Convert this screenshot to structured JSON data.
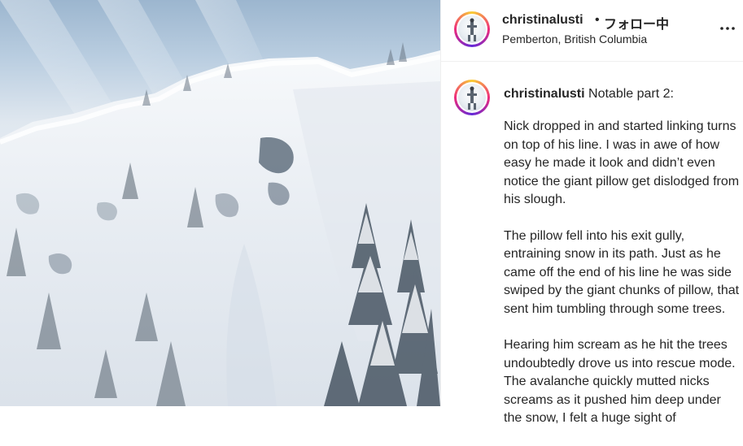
{
  "post": {
    "username": "christinalusti",
    "follow_separator": "•",
    "follow_label": "フォロー中",
    "location": "Pemberton, British Columbia",
    "more_icon": "more-horizontal-icon"
  },
  "media": {
    "subject": "photo"
  },
  "caption": {
    "username": "christinalusti",
    "title": "Notable part 2:",
    "paragraphs": [
      "Nick dropped in and started linking turns on top of his line. I was in awe of how easy he made it look and didn’t even notice the giant pillow get dislodged from his slough.",
      "The pillow fell into his exit gully, entraining snow in its path. Just as he came off the end of his line he was side swiped by the giant chunks of pillow, that sent him tumbling through some trees.",
      "Hearing him scream as he hit the trees undoubtedly drove us into rescue mode. The avalanche quickly mutted nicks screams as it pushed him deep under the snow, I felt a huge sight of"
    ]
  }
}
